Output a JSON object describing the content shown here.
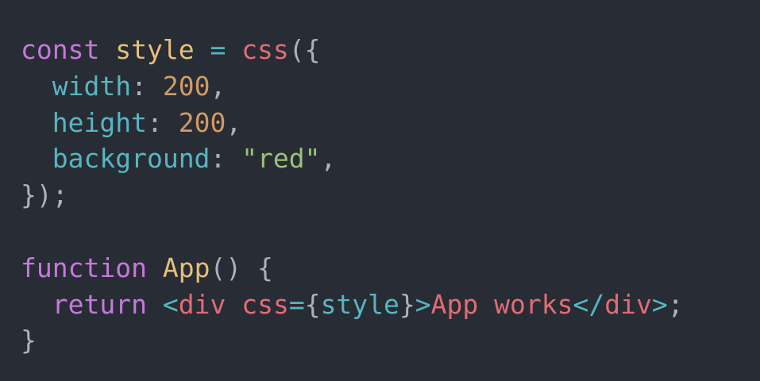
{
  "editor": {
    "background": "#282c34",
    "lines": [
      [
        {
          "text": "const",
          "color": "#c678dd"
        },
        {
          "text": " ",
          "color": "#abb2bf"
        },
        {
          "text": "style",
          "color": "#e5c07b"
        },
        {
          "text": " ",
          "color": "#abb2bf"
        },
        {
          "text": "=",
          "color": "#56b6c2"
        },
        {
          "text": " ",
          "color": "#abb2bf"
        },
        {
          "text": "css",
          "color": "#e06c75"
        },
        {
          "text": "({",
          "color": "#abb2bf"
        }
      ],
      [
        {
          "text": "  ",
          "color": "#abb2bf"
        },
        {
          "text": "width",
          "color": "#56b6c2"
        },
        {
          "text": ": ",
          "color": "#abb2bf"
        },
        {
          "text": "200",
          "color": "#d19a66"
        },
        {
          "text": ",",
          "color": "#abb2bf"
        }
      ],
      [
        {
          "text": "  ",
          "color": "#abb2bf"
        },
        {
          "text": "height",
          "color": "#56b6c2"
        },
        {
          "text": ": ",
          "color": "#abb2bf"
        },
        {
          "text": "200",
          "color": "#d19a66"
        },
        {
          "text": ",",
          "color": "#abb2bf"
        }
      ],
      [
        {
          "text": "  ",
          "color": "#abb2bf"
        },
        {
          "text": "background",
          "color": "#56b6c2"
        },
        {
          "text": ": ",
          "color": "#abb2bf"
        },
        {
          "text": "\"red\"",
          "color": "#98c379"
        },
        {
          "text": ",",
          "color": "#abb2bf"
        }
      ],
      [
        {
          "text": "});",
          "color": "#abb2bf"
        }
      ],
      [],
      [
        {
          "text": "function",
          "color": "#c678dd"
        },
        {
          "text": " ",
          "color": "#abb2bf"
        },
        {
          "text": "App",
          "color": "#e5c07b"
        },
        {
          "text": "() {",
          "color": "#abb2bf"
        }
      ],
      [
        {
          "text": "  ",
          "color": "#abb2bf"
        },
        {
          "text": "return",
          "color": "#c678dd"
        },
        {
          "text": " ",
          "color": "#abb2bf"
        },
        {
          "text": "<",
          "color": "#56b6c2"
        },
        {
          "text": "div",
          "color": "#e06c75"
        },
        {
          "text": " ",
          "color": "#abb2bf"
        },
        {
          "text": "css",
          "color": "#e06c75"
        },
        {
          "text": "=",
          "color": "#56b6c2"
        },
        {
          "text": "{",
          "color": "#abb2bf"
        },
        {
          "text": "style",
          "color": "#56b6c2"
        },
        {
          "text": "}",
          "color": "#abb2bf"
        },
        {
          "text": ">",
          "color": "#56b6c2"
        },
        {
          "text": "App works",
          "color": "#e06c75"
        },
        {
          "text": "</",
          "color": "#56b6c2"
        },
        {
          "text": "div",
          "color": "#e06c75"
        },
        {
          "text": ">",
          "color": "#56b6c2"
        },
        {
          "text": ";",
          "color": "#abb2bf"
        }
      ],
      [
        {
          "text": "}",
          "color": "#abb2bf"
        }
      ]
    ]
  }
}
